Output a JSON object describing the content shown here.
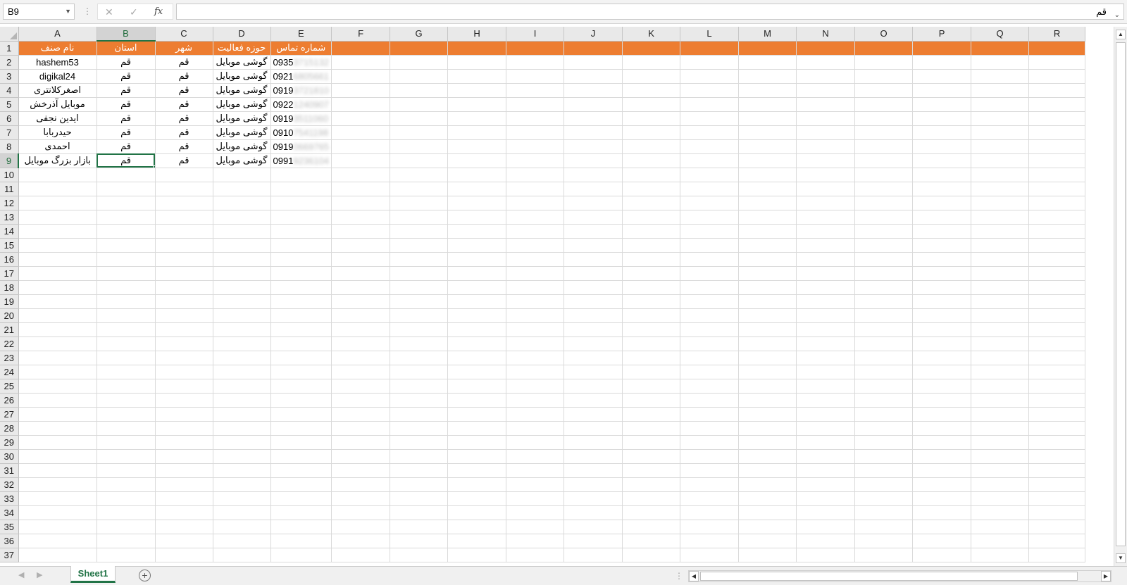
{
  "formula_bar": {
    "name_box": "B9",
    "cancel_icon": "✕",
    "enter_icon": "✓",
    "fx_label": "fx",
    "formula_value": "قم"
  },
  "columns": [
    "A",
    "B",
    "C",
    "D",
    "E",
    "F",
    "G",
    "H",
    "I",
    "J",
    "K",
    "L",
    "M",
    "N",
    "O",
    "P",
    "Q",
    "R"
  ],
  "selected_column": "B",
  "selected_row": 9,
  "row_count": 37,
  "headers": {
    "A": "نام صنف",
    "B": "استان",
    "C": "شهر",
    "D": "حوزه فعالیت",
    "E": "شماره تماس"
  },
  "rows": [
    {
      "name": "hashem53",
      "province": "قم",
      "city": "قم",
      "activity": "گوشی موبایل",
      "phone_visible": "0935",
      "phone_hidden": "3715132"
    },
    {
      "name": "digikal24",
      "province": "قم",
      "city": "قم",
      "activity": "گوشی موبایل",
      "phone_visible": "0921",
      "phone_hidden": "6805661"
    },
    {
      "name": "اصغرکلانتری",
      "province": "قم",
      "city": "قم",
      "activity": "گوشی موبایل",
      "phone_visible": "0919",
      "phone_hidden": "3721810"
    },
    {
      "name": "موبایل آذرخش",
      "province": "قم",
      "city": "قم",
      "activity": "گوشی موبایل",
      "phone_visible": "0922",
      "phone_hidden": "1240907"
    },
    {
      "name": "ایدین نجفی",
      "province": "قم",
      "city": "قم",
      "activity": "گوشی موبایل",
      "phone_visible": "0919",
      "phone_hidden": "3511060"
    },
    {
      "name": "حیدربابا",
      "province": "قم",
      "city": "قم",
      "activity": "گوشی موبایل",
      "phone_visible": "0910",
      "phone_hidden": "7541198"
    },
    {
      "name": "احمدی",
      "province": "قم",
      "city": "قم",
      "activity": "گوشی موبایل",
      "phone_visible": "0919",
      "phone_hidden": "0669765"
    },
    {
      "name": "بازار بزرگ موبایل",
      "province": "قم",
      "city": "قم",
      "activity": "گوشی موبایل",
      "phone_visible": "0991",
      "phone_hidden": "9236104"
    }
  ],
  "sheet_tab": "Sheet1",
  "add_sheet_icon": "+",
  "colors": {
    "header_fill": "#ed7d31",
    "header_text": "#ffffff",
    "accent": "#217346"
  }
}
